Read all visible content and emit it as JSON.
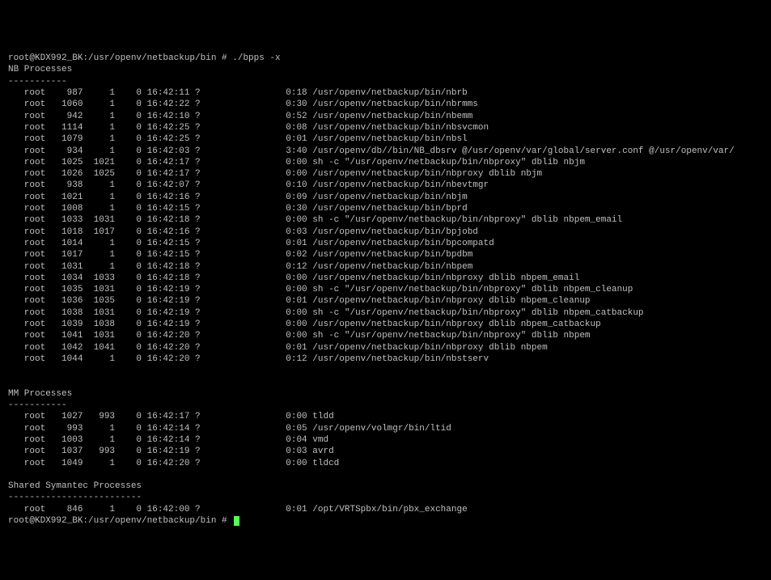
{
  "promptTop": "root@KDX992_BK:/usr/openv/netbackup/bin # ./bpps -x",
  "nbHeader": "NB Processes",
  "nbSep": "-----------",
  "nb": [
    {
      "user": "root",
      "pid": "987",
      "ppid": "1",
      "c": "0",
      "stime": "16:42:11",
      "tty": "?",
      "time": "0:18",
      "cmd": "/usr/openv/netbackup/bin/nbrb"
    },
    {
      "user": "root",
      "pid": "1060",
      "ppid": "1",
      "c": "0",
      "stime": "16:42:22",
      "tty": "?",
      "time": "0:30",
      "cmd": "/usr/openv/netbackup/bin/nbrmms"
    },
    {
      "user": "root",
      "pid": "942",
      "ppid": "1",
      "c": "0",
      "stime": "16:42:10",
      "tty": "?",
      "time": "0:52",
      "cmd": "/usr/openv/netbackup/bin/nbemm"
    },
    {
      "user": "root",
      "pid": "1114",
      "ppid": "1",
      "c": "0",
      "stime": "16:42:25",
      "tty": "?",
      "time": "0:08",
      "cmd": "/usr/openv/netbackup/bin/nbsvcmon"
    },
    {
      "user": "root",
      "pid": "1079",
      "ppid": "1",
      "c": "0",
      "stime": "16:42:25",
      "tty": "?",
      "time": "0:01",
      "cmd": "/usr/openv/netbackup/bin/nbsl"
    },
    {
      "user": "root",
      "pid": "934",
      "ppid": "1",
      "c": "0",
      "stime": "16:42:03",
      "tty": "?",
      "time": "3:40",
      "cmd": "/usr/openv/db//bin/NB_dbsrv @/usr/openv/var/global/server.conf @/usr/openv/var/"
    },
    {
      "user": "root",
      "pid": "1025",
      "ppid": "1021",
      "c": "0",
      "stime": "16:42:17",
      "tty": "?",
      "time": "0:00",
      "cmd": "sh -c \"/usr/openv/netbackup/bin/nbproxy\" dblib nbjm"
    },
    {
      "user": "root",
      "pid": "1026",
      "ppid": "1025",
      "c": "0",
      "stime": "16:42:17",
      "tty": "?",
      "time": "0:00",
      "cmd": "/usr/openv/netbackup/bin/nbproxy dblib nbjm"
    },
    {
      "user": "root",
      "pid": "938",
      "ppid": "1",
      "c": "0",
      "stime": "16:42:07",
      "tty": "?",
      "time": "0:10",
      "cmd": "/usr/openv/netbackup/bin/nbevtmgr"
    },
    {
      "user": "root",
      "pid": "1021",
      "ppid": "1",
      "c": "0",
      "stime": "16:42:16",
      "tty": "?",
      "time": "0:09",
      "cmd": "/usr/openv/netbackup/bin/nbjm"
    },
    {
      "user": "root",
      "pid": "1008",
      "ppid": "1",
      "c": "0",
      "stime": "16:42:15",
      "tty": "?",
      "time": "0:30",
      "cmd": "/usr/openv/netbackup/bin/bprd"
    },
    {
      "user": "root",
      "pid": "1033",
      "ppid": "1031",
      "c": "0",
      "stime": "16:42:18",
      "tty": "?",
      "time": "0:00",
      "cmd": "sh -c \"/usr/openv/netbackup/bin/nbproxy\" dblib nbpem_email"
    },
    {
      "user": "root",
      "pid": "1018",
      "ppid": "1017",
      "c": "0",
      "stime": "16:42:16",
      "tty": "?",
      "time": "0:03",
      "cmd": "/usr/openv/netbackup/bin/bpjobd"
    },
    {
      "user": "root",
      "pid": "1014",
      "ppid": "1",
      "c": "0",
      "stime": "16:42:15",
      "tty": "?",
      "time": "0:01",
      "cmd": "/usr/openv/netbackup/bin/bpcompatd"
    },
    {
      "user": "root",
      "pid": "1017",
      "ppid": "1",
      "c": "0",
      "stime": "16:42:15",
      "tty": "?",
      "time": "0:02",
      "cmd": "/usr/openv/netbackup/bin/bpdbm"
    },
    {
      "user": "root",
      "pid": "1031",
      "ppid": "1",
      "c": "0",
      "stime": "16:42:18",
      "tty": "?",
      "time": "0:12",
      "cmd": "/usr/openv/netbackup/bin/nbpem"
    },
    {
      "user": "root",
      "pid": "1034",
      "ppid": "1033",
      "c": "0",
      "stime": "16:42:18",
      "tty": "?",
      "time": "0:00",
      "cmd": "/usr/openv/netbackup/bin/nbproxy dblib nbpem_email"
    },
    {
      "user": "root",
      "pid": "1035",
      "ppid": "1031",
      "c": "0",
      "stime": "16:42:19",
      "tty": "?",
      "time": "0:00",
      "cmd": "sh -c \"/usr/openv/netbackup/bin/nbproxy\" dblib nbpem_cleanup"
    },
    {
      "user": "root",
      "pid": "1036",
      "ppid": "1035",
      "c": "0",
      "stime": "16:42:19",
      "tty": "?",
      "time": "0:01",
      "cmd": "/usr/openv/netbackup/bin/nbproxy dblib nbpem_cleanup"
    },
    {
      "user": "root",
      "pid": "1038",
      "ppid": "1031",
      "c": "0",
      "stime": "16:42:19",
      "tty": "?",
      "time": "0:00",
      "cmd": "sh -c \"/usr/openv/netbackup/bin/nbproxy\" dblib nbpem_catbackup"
    },
    {
      "user": "root",
      "pid": "1039",
      "ppid": "1038",
      "c": "0",
      "stime": "16:42:19",
      "tty": "?",
      "time": "0:00",
      "cmd": "/usr/openv/netbackup/bin/nbproxy dblib nbpem_catbackup"
    },
    {
      "user": "root",
      "pid": "1041",
      "ppid": "1031",
      "c": "0",
      "stime": "16:42:20",
      "tty": "?",
      "time": "0:00",
      "cmd": "sh -c \"/usr/openv/netbackup/bin/nbproxy\" dblib nbpem"
    },
    {
      "user": "root",
      "pid": "1042",
      "ppid": "1041",
      "c": "0",
      "stime": "16:42:20",
      "tty": "?",
      "time": "0:01",
      "cmd": "/usr/openv/netbackup/bin/nbproxy dblib nbpem"
    },
    {
      "user": "root",
      "pid": "1044",
      "ppid": "1",
      "c": "0",
      "stime": "16:42:20",
      "tty": "?",
      "time": "0:12",
      "cmd": "/usr/openv/netbackup/bin/nbstserv"
    }
  ],
  "mmHeader": "MM Processes",
  "mmSep": "-----------",
  "mm": [
    {
      "user": "root",
      "pid": "1027",
      "ppid": "993",
      "c": "0",
      "stime": "16:42:17",
      "tty": "?",
      "time": "0:00",
      "cmd": "tldd"
    },
    {
      "user": "root",
      "pid": "993",
      "ppid": "1",
      "c": "0",
      "stime": "16:42:14",
      "tty": "?",
      "time": "0:05",
      "cmd": "/usr/openv/volmgr/bin/ltid"
    },
    {
      "user": "root",
      "pid": "1003",
      "ppid": "1",
      "c": "0",
      "stime": "16:42:14",
      "tty": "?",
      "time": "0:04",
      "cmd": "vmd"
    },
    {
      "user": "root",
      "pid": "1037",
      "ppid": "993",
      "c": "0",
      "stime": "16:42:19",
      "tty": "?",
      "time": "0:03",
      "cmd": "avrd"
    },
    {
      "user": "root",
      "pid": "1049",
      "ppid": "1",
      "c": "0",
      "stime": "16:42:20",
      "tty": "?",
      "time": "0:00",
      "cmd": "tldcd"
    }
  ],
  "shHeader": "Shared Symantec Processes",
  "shSep": "-------------------------",
  "sh": [
    {
      "user": "root",
      "pid": "846",
      "ppid": "1",
      "c": "0",
      "stime": "16:42:00",
      "tty": "?",
      "time": "0:01",
      "cmd": "/opt/VRTSpbx/bin/pbx_exchange"
    }
  ],
  "promptBottom": "root@KDX992_BK:/usr/openv/netbackup/bin #"
}
